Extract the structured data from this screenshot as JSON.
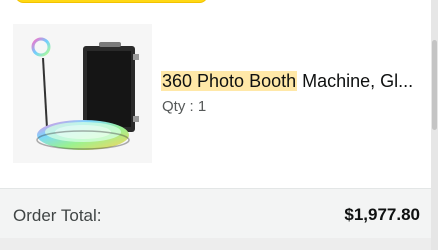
{
  "product": {
    "title_highlight": "360 Photo Booth",
    "title_rest": " Machine, Gl...",
    "qty_label": "Qty",
    "qty_separator": " : ",
    "qty_value": "1",
    "image_icon": "product-photo-360-photo-booth"
  },
  "order": {
    "total_label": "Order Total:",
    "total_value": "$1,977.80"
  },
  "colors": {
    "button_yellow": "#ffd814",
    "highlight": "#ffe8a8",
    "total_background": "#f3f4f4",
    "text_primary": "#0f1111",
    "text_secondary": "#565959"
  }
}
